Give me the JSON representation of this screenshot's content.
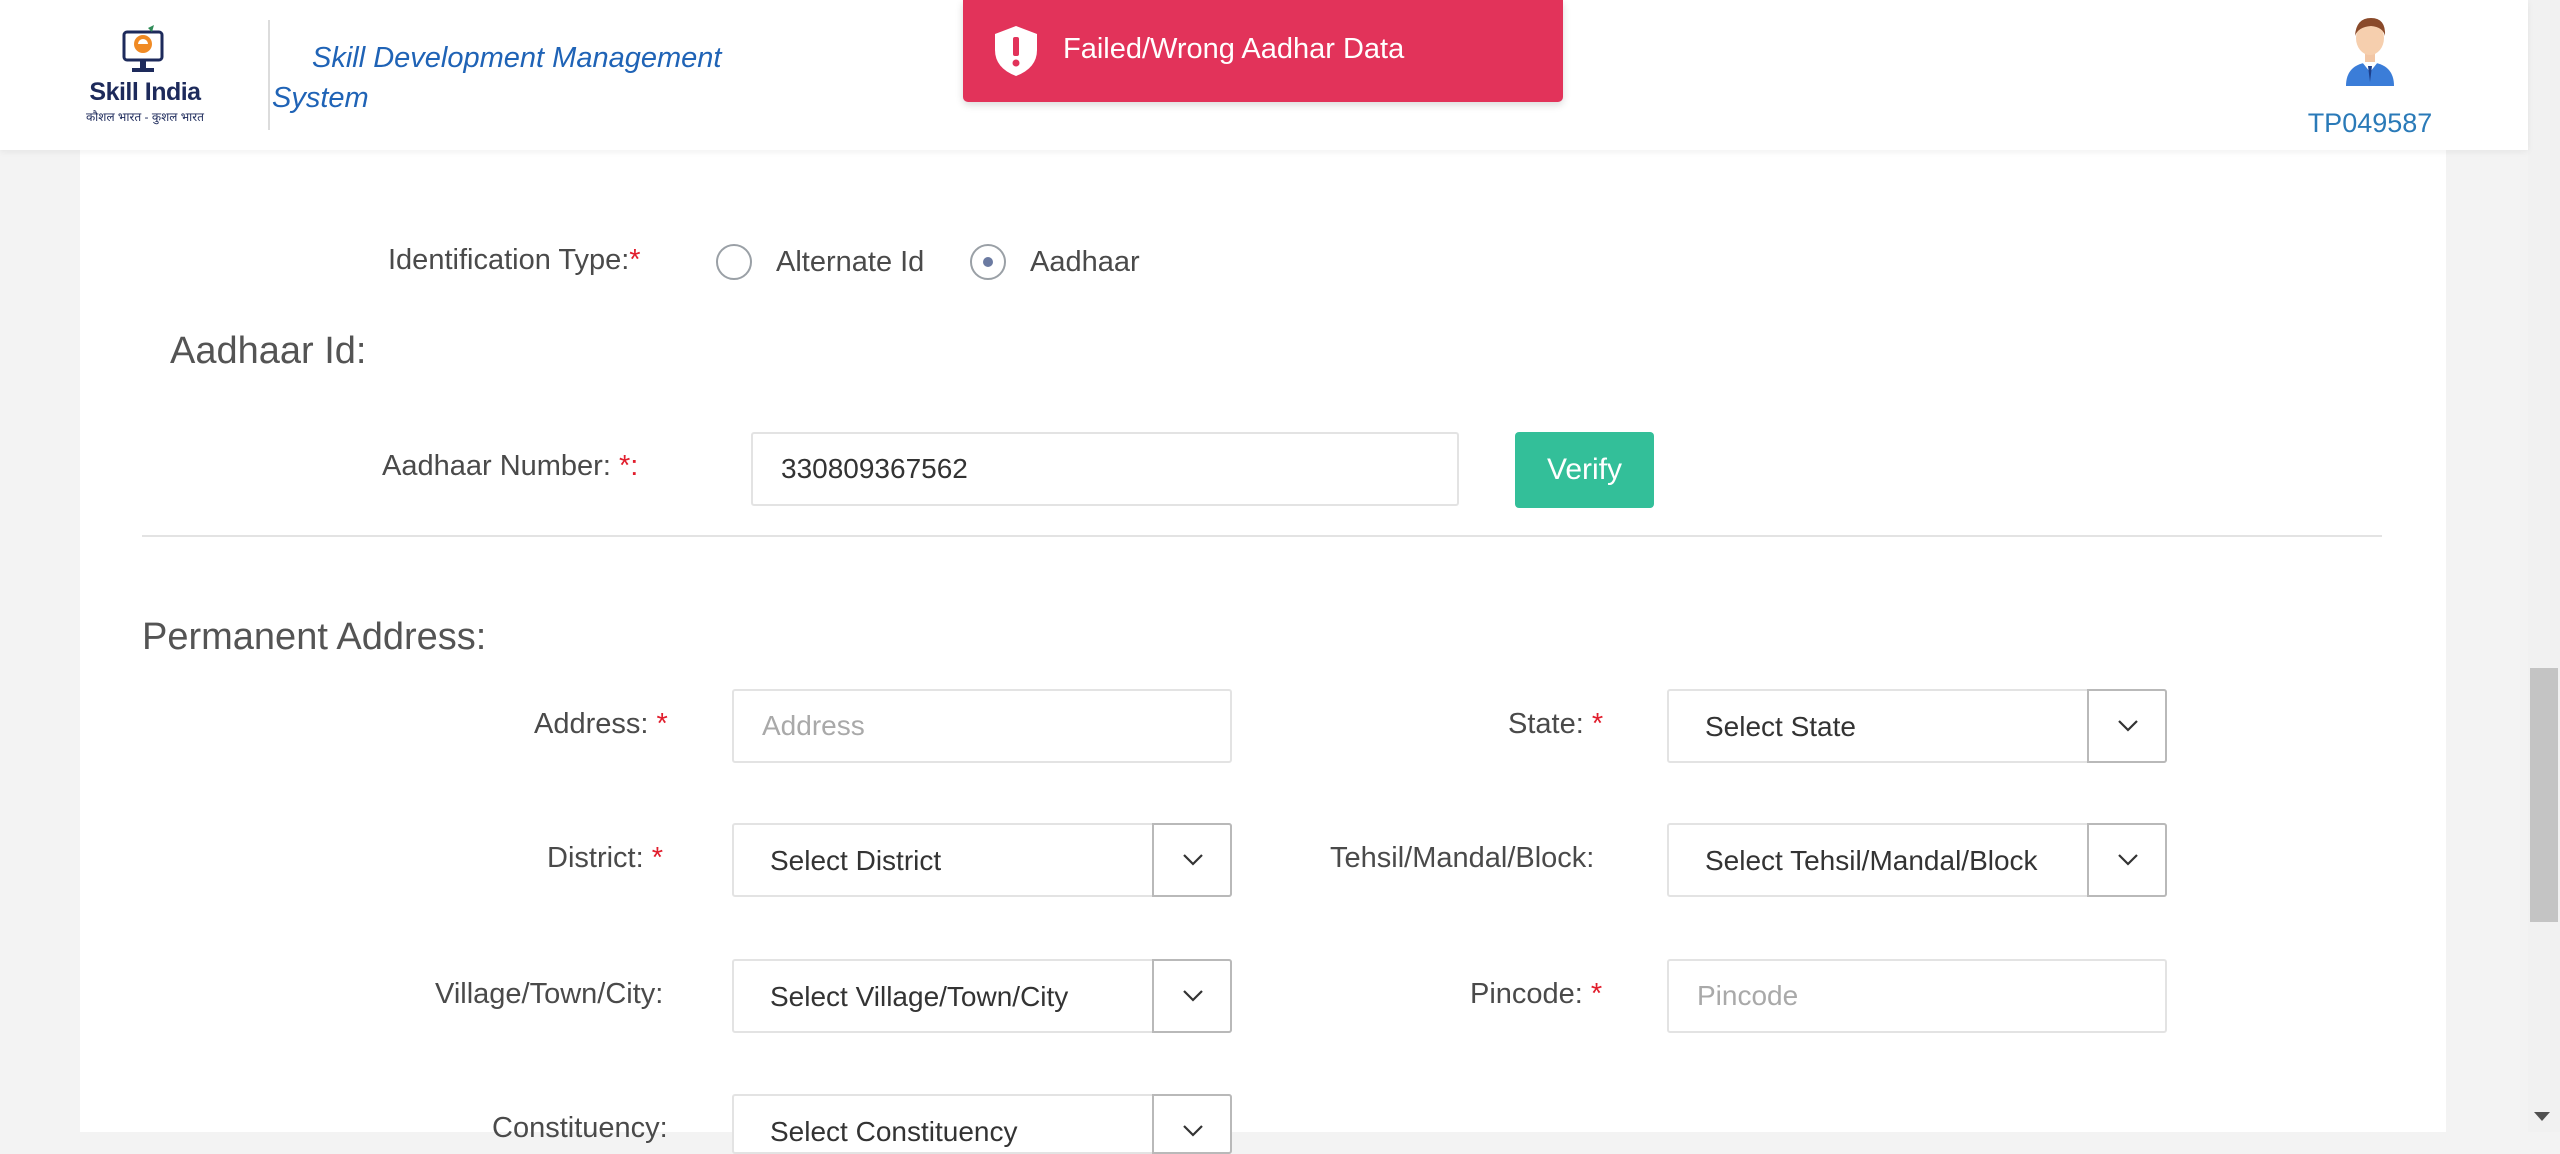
{
  "header": {
    "logo_name": "Skill India",
    "logo_tagline": "कौशल भारत - कुशल भारत",
    "app_title": "Skill Development Management System",
    "user_id": "TP049587"
  },
  "toast": {
    "message": "Failed/Wrong Aadhar Data",
    "color": "#e2335a",
    "icon": "alert-shield-icon"
  },
  "identification": {
    "label": "Identification Type:",
    "required_mark": "*",
    "options": [
      {
        "label": "Alternate Id",
        "selected": false
      },
      {
        "label": "Aadhaar",
        "selected": true
      }
    ]
  },
  "aadhaar": {
    "section_title": "Aadhaar Id:",
    "number_label": "Aadhaar Number:",
    "required_mark": "*",
    "number_suffix": ":",
    "number_value": "330809367562",
    "verify_label": "Verify",
    "verify_color": "#33bf99"
  },
  "permanent_address": {
    "section_title": "Permanent Address:",
    "address": {
      "label": "Address:",
      "required": "*",
      "placeholder": "Address"
    },
    "state": {
      "label": "State:",
      "required": "*",
      "value": "Select State"
    },
    "district": {
      "label": "District:",
      "required": "*",
      "value": "Select District"
    },
    "tehsil": {
      "label": "Tehsil/Mandal/Block:",
      "value": "Select Tehsil/Mandal/Block"
    },
    "village": {
      "label": "Village/Town/City:",
      "value": "Select Village/Town/City"
    },
    "pincode": {
      "label": "Pincode:",
      "required": "*",
      "placeholder": "Pincode"
    },
    "constituency": {
      "label": "Constituency:",
      "value": "Select Constituency"
    }
  }
}
